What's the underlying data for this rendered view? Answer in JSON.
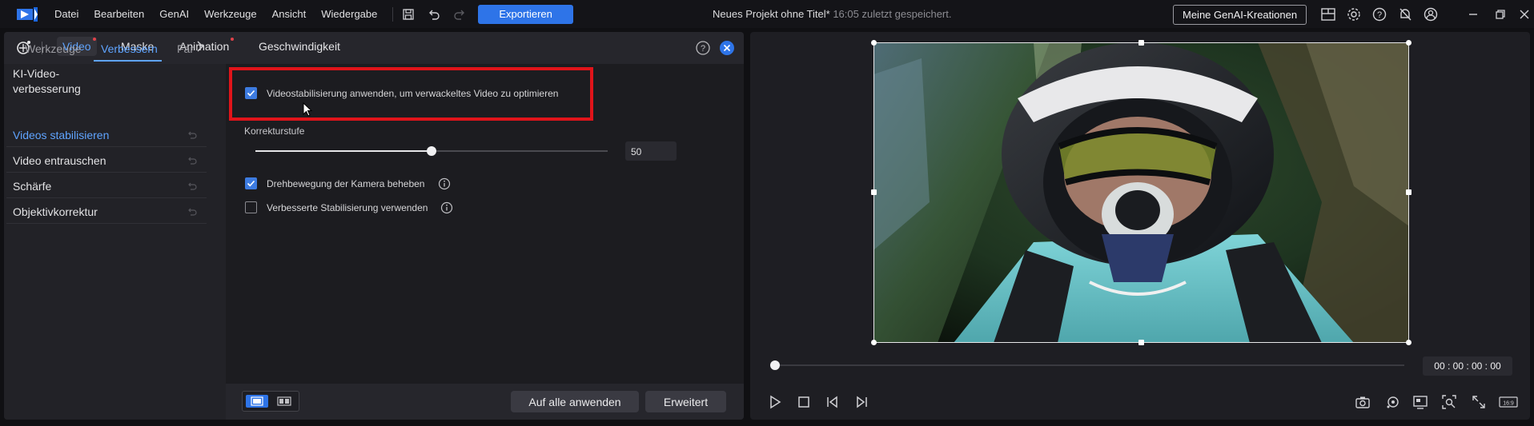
{
  "menu": {
    "items": [
      "Datei",
      "Bearbeiten",
      "GenAI",
      "Werkzeuge",
      "Ansicht",
      "Wiedergabe"
    ],
    "export_label": "Exportieren"
  },
  "project": {
    "name": "Neues Projekt ohne Titel*",
    "saved": "16:05 zuletzt gespeichert."
  },
  "genai_button": "Meine GenAI-Kreationen",
  "editor": {
    "tabs": [
      "Video",
      "Maske",
      "Animation",
      "Geschwindigkeit"
    ],
    "active_tab": "Video",
    "subtabs": [
      "Werkzeuge",
      "Verbessern",
      "Far"
    ],
    "active_subtab": "Verbessern",
    "sidebar_group": "KI-Video-verbesserung",
    "sidebar_items": [
      "Videos stabilisieren",
      "Video entrauschen",
      "Schärfe",
      "Objektivkorrektur"
    ],
    "active_item": "Videos stabilisieren",
    "stabilize_option": "Videostabilisierung anwenden, um verwackeltes Video zu optimieren",
    "stabilize_checked": true,
    "slider_label": "Korrekturstufe",
    "slider_value": "50",
    "slider_fraction": 0.5,
    "rotation_option": "Drehbewegung der Kamera beheben",
    "rotation_checked": true,
    "enhanced_option": "Verbesserte Stabilisierung verwenden",
    "enhanced_checked": false,
    "apply_all": "Auf alle anwenden",
    "advanced": "Erweitert"
  },
  "preview": {
    "timecode": "00 : 00 : 00 : 00",
    "aspect_label": "16:9",
    "position_fraction": 0.0
  },
  "colors": {
    "accent": "#2e74e8",
    "highlight": "#e0141a",
    "active_text": "#5fa4ff"
  }
}
